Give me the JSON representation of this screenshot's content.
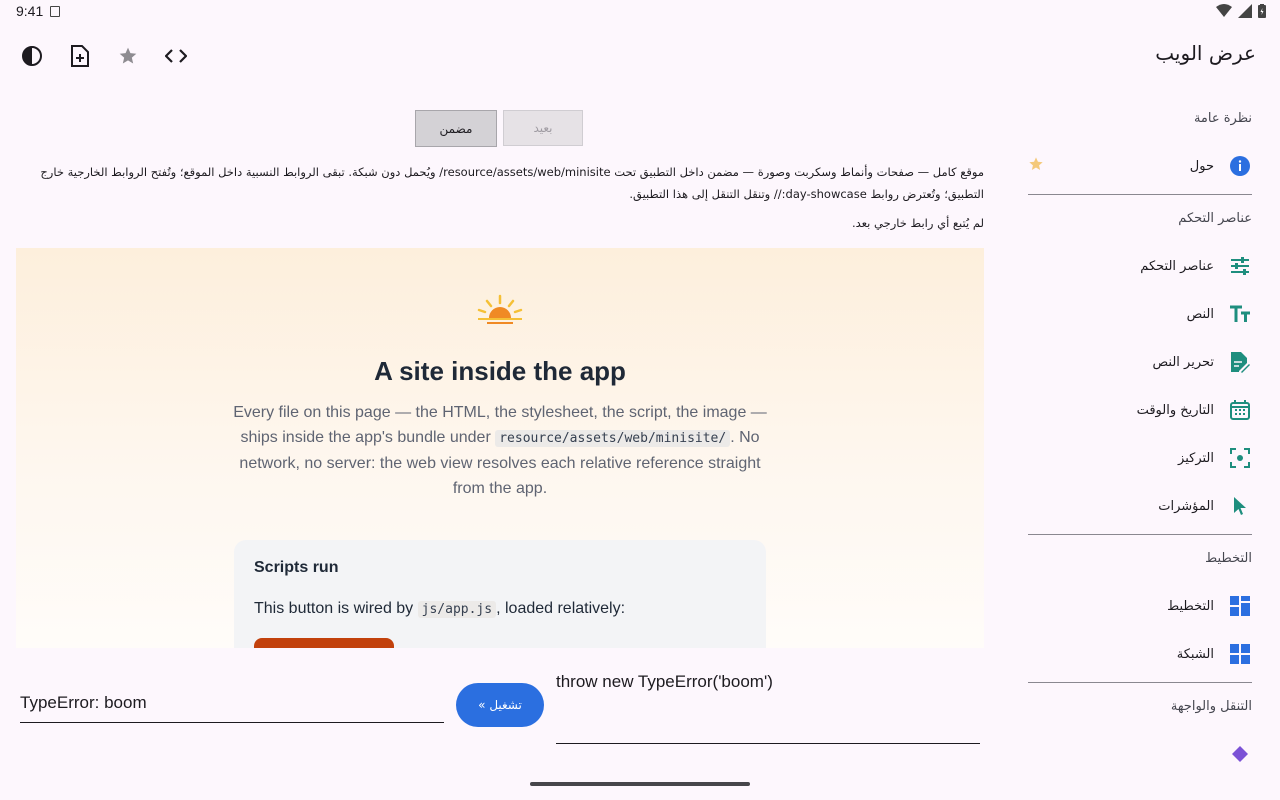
{
  "status_bar": {
    "time": "9:41"
  },
  "app_bar": {
    "title": "عرض الويب"
  },
  "sidebar": {
    "sections": [
      {
        "title": "نظرة عامة",
        "items": [
          {
            "label": "حول",
            "icon": "info-icon",
            "starred": true
          }
        ]
      },
      {
        "title": "عناصر التحكم",
        "items": [
          {
            "label": "عناصر التحكم",
            "icon": "sliders-icon"
          },
          {
            "label": "النص",
            "icon": "text-size-icon"
          },
          {
            "label": "تحرير النص",
            "icon": "edit-document-icon"
          },
          {
            "label": "التاريخ والوقت",
            "icon": "calendar-icon"
          },
          {
            "label": "التركيز",
            "icon": "focus-icon"
          },
          {
            "label": "المؤشرات",
            "icon": "pointer-icon"
          }
        ]
      },
      {
        "title": "التخطيط",
        "items": [
          {
            "label": "التخطيط",
            "icon": "layout-icon"
          },
          {
            "label": "الشبكة",
            "icon": "grid-icon"
          }
        ]
      },
      {
        "title": "التنقل والواجهة",
        "items": [
          {
            "label": "",
            "icon": "diamond-icon"
          }
        ]
      }
    ]
  },
  "mode_buttons": {
    "remote": "بعيد",
    "embedded": "مضمن"
  },
  "description": "موقع كامل — صفحات وأنماط وسكربت وصورة — مضمن داخل التطبيق تحت resource/assets/web/minisite/ ويُحمل دون شبكة. تبقى الروابط النسبية داخل الموقع؛ وتُفتح الروابط الخارجية خارج التطبيق؛ وتُعترض روابط day-showcase:// وتنقل التنقل إلى هذا التطبيق.",
  "external_status": "لم يُتبع أي رابط خارجي بعد.",
  "web": {
    "heading": "A site inside the app",
    "lead_1": "Every file on this page — the HTML, the stylesheet, the script, the image — ships inside the app's bundle under",
    "lead_code": "resource/assets/web/minisite/",
    "lead_2": ". No network, no server: the web view resolves each relative reference straight from the app.",
    "card_title": "Scripts run",
    "card_text_1": "This button is wired by",
    "card_code": "js/app.js",
    "card_text_2": ", loaded relatively:"
  },
  "console": {
    "output": "TypeError: boom",
    "run_label": "تشغيل »",
    "code": "throw new TypeError('boom')"
  },
  "colors": {
    "accent": "#2b6fe0",
    "teal_icon": "#1e8e7e",
    "blue_icon": "#2b6fe0",
    "star": "#f4c97a"
  }
}
